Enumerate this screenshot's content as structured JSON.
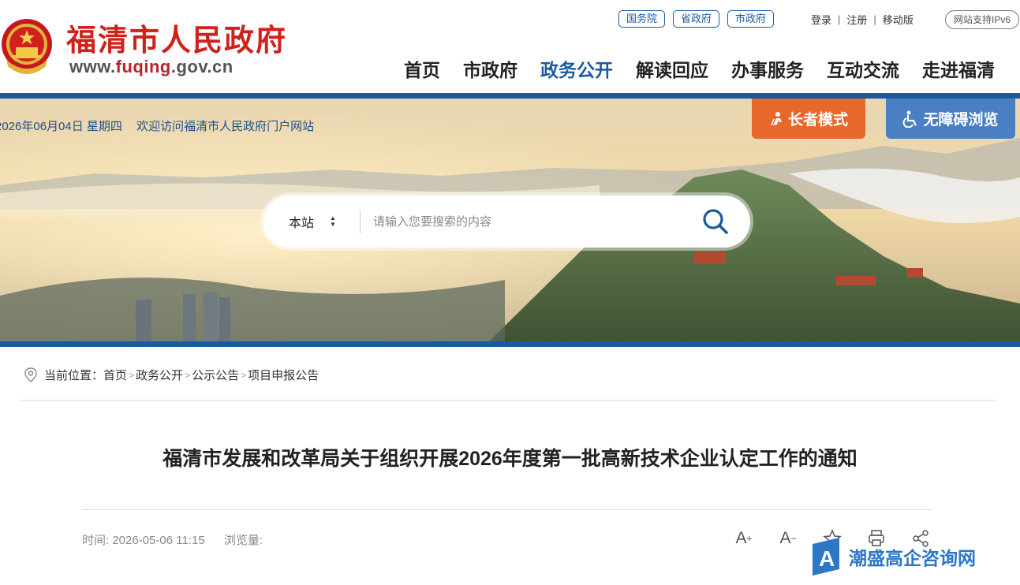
{
  "header": {
    "site_title": "福清市人民政府",
    "site_url": "www.fuqing.gov.cn",
    "top_links": [
      "国务院",
      "省政府",
      "市政府"
    ],
    "user_links": [
      "登录",
      "注册",
      "移动版"
    ],
    "ipv6_badge": "网站支持IPv6",
    "nav": [
      "首页",
      "市政府",
      "政务公开",
      "解读回应",
      "办事服务",
      "互动交流",
      "走进福清"
    ],
    "nav_active": "政务公开"
  },
  "banner": {
    "date_text": "2026年06月04日 星期四",
    "welcome_text": "欢迎访问福清市人民政府门户网站",
    "elder_mode_label": "长者模式",
    "accessibility_label": "无障碍浏览",
    "search": {
      "scope": "本站",
      "placeholder": "请输入您要搜索的内容"
    }
  },
  "breadcrumb": {
    "prefix": "当前位置：",
    "items": [
      "首页",
      "政务公开",
      "公示公告",
      "项目申报公告"
    ]
  },
  "article": {
    "title": "福清市发展和改革局关于组织开展2026年度第一批高新技术企业认定工作的通知",
    "time_label": "时间:",
    "time_value": "2026-05-06 11:15",
    "views_label": "浏览量:",
    "tools": [
      "font-increase-icon",
      "font-decrease-icon",
      "favorite-icon",
      "print-icon",
      "share-icon"
    ]
  },
  "watermark": {
    "text": "潮盛高企咨询网"
  },
  "colors": {
    "brand_blue": "#1c5a9e",
    "title_red": "#d0211c",
    "elder_orange": "#e8672a",
    "access_blue": "#4a7fc4"
  }
}
